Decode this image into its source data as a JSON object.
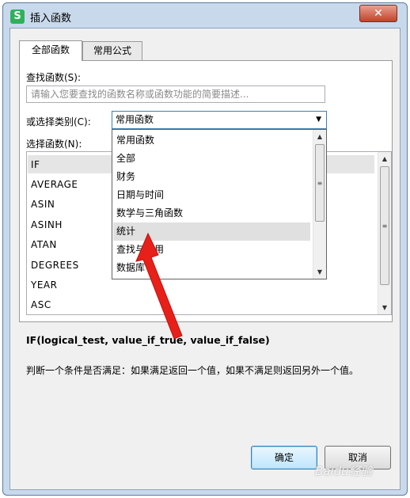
{
  "window": {
    "title": "插入函数",
    "app_icon_letter": "S"
  },
  "tabs": [
    {
      "label": "全部函数",
      "active": true
    },
    {
      "label": "常用公式",
      "active": false
    }
  ],
  "search": {
    "label": "查找函数(S):",
    "placeholder": "请输入您要查找的函数名称或函数功能的简要描述..."
  },
  "category": {
    "label": "或选择类别(C):",
    "selected": "常用函数"
  },
  "function_list": {
    "label": "选择函数(N):",
    "items": [
      "IF",
      "AVERAGE",
      "ASIN",
      "ASINH",
      "ATAN",
      "DEGREES",
      "YEAR",
      "ASC"
    ],
    "selected": "IF"
  },
  "dropdown": {
    "items": [
      "常用函数",
      "全部",
      "财务",
      "日期与时间",
      "数学与三角函数",
      "统计",
      "查找与引用",
      "数据库"
    ],
    "highlighted": "统计"
  },
  "syntax": "IF(logical_test, value_if_true, value_if_false)",
  "description": "判断一个条件是否满足：如果满足返回一个值，如果不满足则返回另外一个值。",
  "buttons": {
    "ok": "确定",
    "cancel": "取消"
  },
  "watermark": "Baidu经验",
  "colors": {
    "annotation_arrow": "#e8201a",
    "app_icon": "#2fb15c",
    "close_button": "#c4422b"
  },
  "icons": {
    "close": "close-icon",
    "dropdown": "chevron-down-icon",
    "scroll_up": "scroll-up-icon",
    "scroll_down": "scroll-down-icon"
  }
}
